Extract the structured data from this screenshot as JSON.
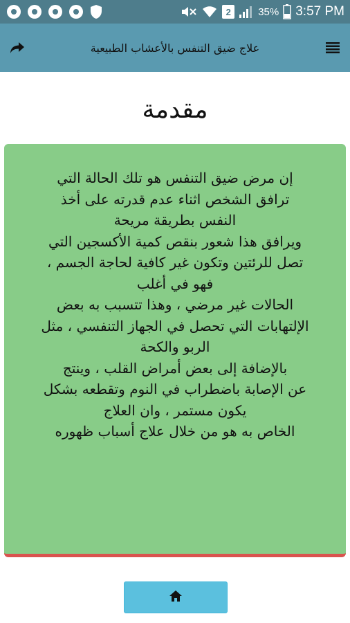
{
  "status_bar": {
    "battery_percent": "35%",
    "time": "3:57 PM",
    "sim_slot": "2",
    "icons": [
      "notification-icon",
      "notification-icon",
      "notification-icon",
      "notification-icon",
      "shield-icon",
      "mute-icon",
      "wifi-icon",
      "sim-icon",
      "signal-icon",
      "battery-icon"
    ]
  },
  "toolbar": {
    "title": "علاج ضيق التنفس بالأعشاب الطبيعية",
    "menu_icon": "menu-icon",
    "share_icon": "share-arrow-icon"
  },
  "page": {
    "title": "مقدمة",
    "body": "إن مرض ضيق التنفس هو تلك الحالة التي\nترافق الشخص اثناء عدم قدرته على أخذ\nالنفس بطريقة مريحة\nويرافق هذا شعور بنقص كمية الأكسجين التي\nتصل للرئتين وتكون غير كافية لحاجة الجسم ،\nفهو في أغلب\nالحالات غير مرضي ، وهذا تتسبب به بعض\nالإلتهابات التي تحصل في الجهاز التنفسي ، مثل\nالربو والكحة\nبالإضافة إلى بعض أمراض القلب ، وينتج\nعن الإصابة باضطراب في النوم وتقطعه بشكل\nيكون مستمر ، وان العلاج\nالخاص به هو من خلال علاج أسباب ظهوره"
  },
  "home_button": {
    "icon": "home-icon"
  },
  "colors": {
    "status_bar": "#4e7d8c",
    "toolbar": "#5a9ab0",
    "card": "#88cc88",
    "card_border": "#d9534f",
    "home_button": "#5bc0de"
  }
}
